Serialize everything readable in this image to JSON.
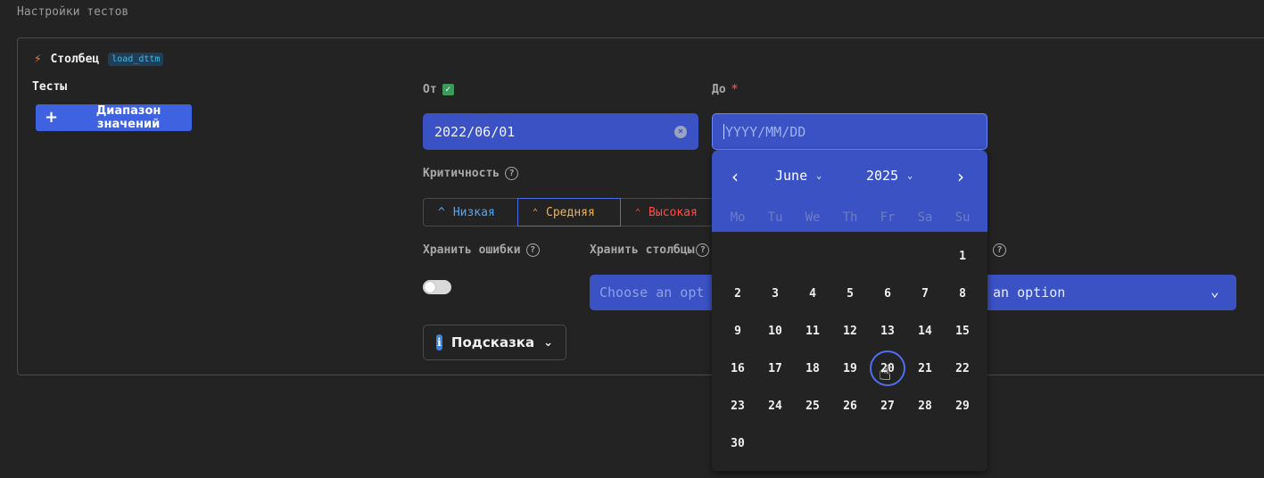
{
  "section_title": "Настройки тестов",
  "column": {
    "label": "Столбец",
    "tag": "load_dttm"
  },
  "tests_label": "Тесты",
  "add_button": "Диапазон значений",
  "from": {
    "label": "От",
    "value": "2022/06/01"
  },
  "to": {
    "label": "До",
    "required": "*",
    "placeholder": "YYYY/MM/DD"
  },
  "criticality": {
    "label": "Критичность",
    "options": [
      {
        "icon": "^",
        "label": "Низкая"
      },
      {
        "icon": "⌃⌃",
        "label": "Средняя"
      },
      {
        "icon": "⌃⌃",
        "label": "Высокая"
      }
    ],
    "selected": "Средняя"
  },
  "store_errors": {
    "label": "Хранить ошибки"
  },
  "store_columns": {
    "label": "Хранить столбцы"
  },
  "select_left_placeholder": "Choose an opt",
  "select_right_text": "an option",
  "hint_button": "Подсказка",
  "calendar": {
    "month": "June",
    "year": "2025",
    "weekdays": [
      "Mo",
      "Tu",
      "We",
      "Th",
      "Fr",
      "Sa",
      "Su"
    ],
    "first_weekday_index": 6,
    "days_in_month": 30,
    "hovered_day": 20
  },
  "colors": {
    "accent": "#3a52c4",
    "button": "#3f63e0",
    "bg": "#232323"
  },
  "icons": [
    "bolt-icon",
    "plus-icon",
    "check-icon",
    "help-icon",
    "clear-icon",
    "chevron-left-icon",
    "chevron-right-icon",
    "chevron-down-icon",
    "info-icon",
    "pointer-cursor-icon"
  ]
}
